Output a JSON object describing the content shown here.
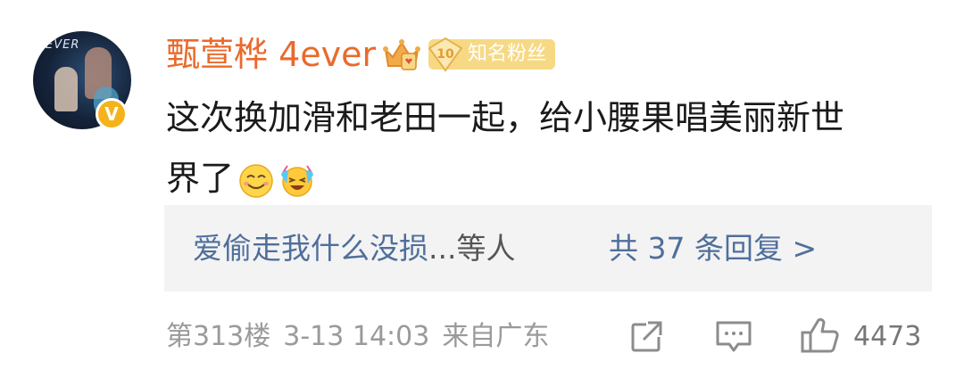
{
  "comment": {
    "username": "甄萱桦 4ever",
    "fan_badge": {
      "level": "10",
      "label": "知名粉丝"
    },
    "verified_mark": "V",
    "text_line1": "这次换加滑和老田一起，给小腰果唱美丽新世",
    "text_line2": "界了",
    "emojis": [
      "smile-face-icon",
      "laugh-cry-face-icon"
    ],
    "replies": {
      "users_preview": "爱偷走我什么没损",
      "etc": "...等人",
      "count_link": "共 37 条回复 >"
    },
    "floor": "第313楼",
    "date": "3-13 14:03",
    "location": "来自广东",
    "likes": "4473"
  },
  "avatar_image_text": "EVER",
  "colors": {
    "username": "#ea6a2c",
    "link": "#4f6f9b",
    "meta": "#9a9a9a",
    "badge_bg": "#f7d985",
    "verified": "#f4b31a",
    "reply_bg": "#f3f3f3"
  }
}
